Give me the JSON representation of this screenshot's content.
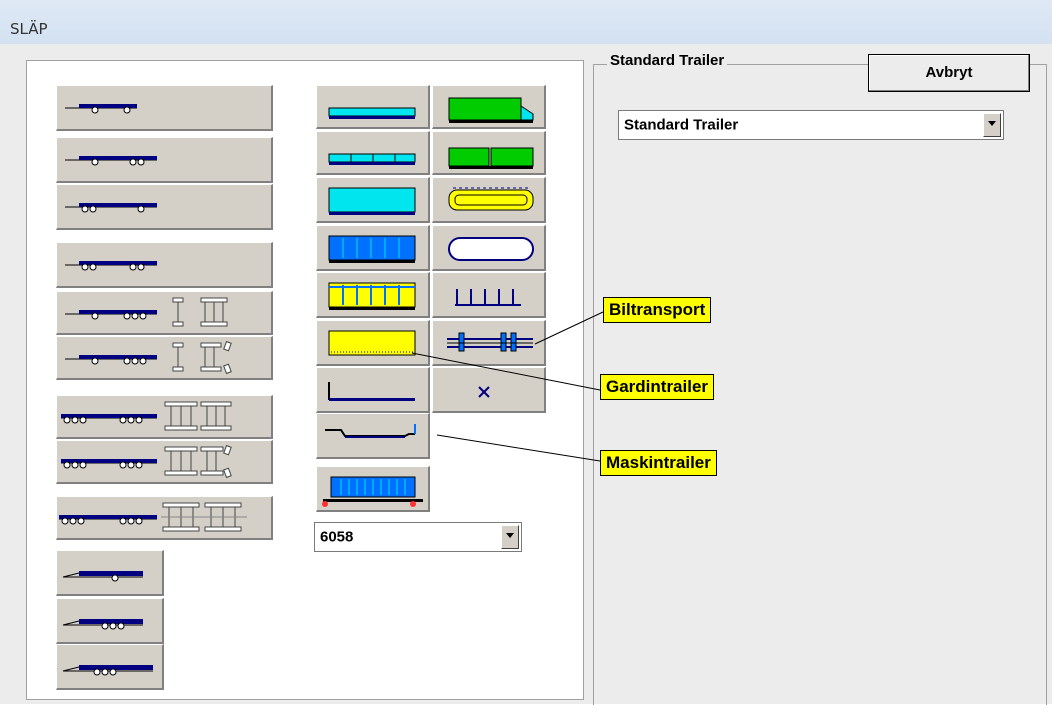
{
  "window": {
    "title": "SLÄP"
  },
  "group": {
    "label": "Standard Trailer"
  },
  "buttons": {
    "cancel": "Avbryt"
  },
  "trailer_type": {
    "selected": "Standard Trailer"
  },
  "size_select": {
    "selected": "6058"
  },
  "callouts": {
    "biltransport": "Biltransport",
    "gardintrailer": "Gardintrailer",
    "maskintrailer": "Maskintrailer"
  },
  "colors": {
    "body_cyan": "#00e5ee",
    "body_green": "#00cc00",
    "body_yellow": "#ffff00",
    "body_blue": "#0070ff",
    "chassis_navy": "#000080",
    "callout_bg": "#ffff00"
  },
  "icons": {
    "close_body": "x-icon"
  }
}
